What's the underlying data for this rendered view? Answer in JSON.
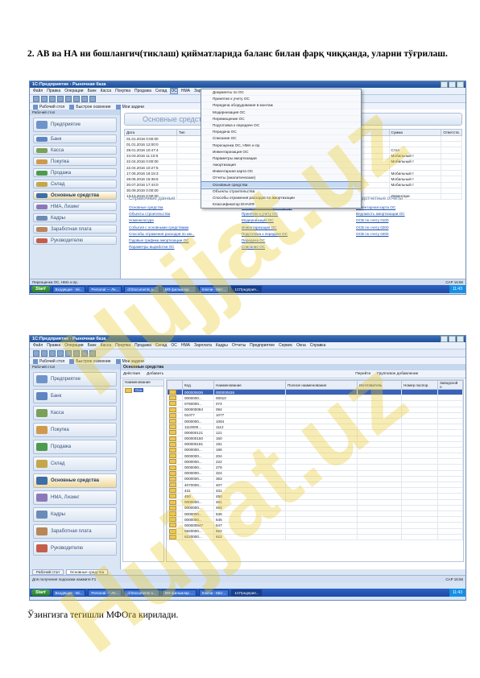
{
  "heading": "2. АВ ва НА ни бошлангич(тиклаш) қийматларида баланс билан фарқ чиққанда, уларни тўғрилаш.",
  "caption": "Ўзингизга тегишли МФОга кирилади.",
  "watermark": "Hujjat.uz",
  "app": {
    "title": "1С:Предприятие - Рыночная база",
    "menu": [
      "Файл",
      "Правка",
      "Операции",
      "Банк",
      "Касса",
      "Покупка",
      "Продажа",
      "Склад",
      "ОС",
      "НМА",
      "Зарплата",
      "Кадры",
      "Отчеты",
      "Предприятие",
      "Сервис",
      "Окна",
      "Справка"
    ],
    "panel": {
      "desktop": "Рабочий стол",
      "quick": "Быстрое освоение",
      "mine": "Мои задачи"
    },
    "side_title": "Рабочий стол",
    "sections": [
      "Предприятие",
      "Банк",
      "Касса",
      "Покупка",
      "Продажа",
      "Склад",
      "Основные средства",
      "НМА, Лизинг",
      "Кадры",
      "Заработная плата",
      "Руководителю"
    ],
    "taskbar": {
      "start": "Start",
      "tasks": [
        "Входящие - Mi...",
        "Personal — Ле...",
        "d:\\Documents a...",
        "МФ фильмлар ...",
        "Ключи - Micr...",
        "1СПредприя..."
      ],
      "clock": "11:43"
    }
  },
  "shot1": {
    "tab": "Основные средства",
    "status": "Переоценка ОС, НМА и пр.",
    "bottom_tab": "Рабочий стол",
    "context_menu": [
      "Документы по ОС",
      "Принятие к учету ОС",
      "Передача оборудования в монтаж",
      "Модернизация ОС",
      "Перемещение ОС",
      "Подготовка к передаче ОС",
      "Передача ОС",
      "Списание ОС",
      "Переоценка ОС, НМА и пр.",
      "Инвентаризация ОС",
      "Параметры амортизации",
      "Амортизация",
      "Инвентарная карта ОС",
      "Отчеты (аналитические)",
      "Основные средства",
      "Объекты строительства",
      "Способы отражения расходов по амортизации",
      "Классификатор ЕНАОФ"
    ],
    "highlighted": "Переоценка ОС, НМА и пр.",
    "list_header": [
      "Дата",
      "Тип",
      "Наименование",
      "Организация",
      "Сумма",
      "Ответств."
    ],
    "list_rows": [
      [
        "01.01.2016 0:00:00",
        "",
        "",
        "МФ",
        ""
      ],
      [
        "01.01.2016 12:00:0",
        "",
        "",
        "МФ",
        ""
      ],
      [
        "28.01.2016 10:47:4",
        "",
        "",
        "МФ",
        "Стол"
      ],
      [
        "24.03.2016 11:10:5",
        "",
        "",
        "МФ",
        "Мобильный т"
      ],
      [
        "22.04.2016 0:00:00",
        "",
        "",
        "МФ",
        "Мобильный т"
      ],
      [
        "22.04.2016 10:27:5",
        "",
        "",
        "МФ",
        ""
      ],
      [
        "17.06.2016 16:15:3",
        "",
        "",
        "МФ",
        "Мобильный т"
      ],
      [
        "28.06.2016 15:36:5",
        "",
        "",
        "МФ",
        "Мобильный т"
      ],
      [
        "20.07.2016 17:44:0",
        "",
        "",
        "МФ",
        "Мобильный т"
      ],
      [
        "30.09.2016 0:00:00",
        "",
        "Основные средства",
        "МФ",
        ""
      ],
      [
        "13.10.2016 0:00:00",
        "",
        "",
        "МФ",
        "Инвентари"
      ]
    ],
    "links_left": [
      "Основные средства",
      "Объекты строительства",
      "Номенклатура",
      "События с основными средствами",
      "Способы отражения расходов по ам...",
      "Годовые графики амортизации ОС",
      "Параметры выработки ОС"
    ],
    "links_mid": [
      "Поступление товаров и услуг",
      "Принятие к учету ОС",
      "Модернизация ОС",
      "Инвентаризация ОС",
      "Подготовка к передаче ОС",
      "Передача ОС",
      "Списание ОС"
    ],
    "links_right": [
      "Инвентарная карта ОС",
      "Ведомость амортизации ОС",
      "ОСВ по счету 0100",
      "ОСВ по счету 0200",
      "ОСВ по счету 0400"
    ],
    "section_docs": "Справочные данные",
    "section_reports": "Подотчетные отчеты",
    "date_right": "CAP 16:56"
  },
  "shot2": {
    "tab": "Основные средства",
    "toolbar": [
      "Действия",
      "Добавить",
      "Перейти",
      "Групповое добавление"
    ],
    "columns": [
      "Наименование",
      "Код",
      "Наименование",
      "Полное наименование",
      "Изготовитель",
      "Номер паспор.",
      "Заводской н"
    ],
    "tree_root": "Осн",
    "rows": [
      [
        "000000636",
        "000000636"
      ],
      [
        "0000000...",
        "00010"
      ],
      [
        "0760000...",
        "074"
      ],
      [
        "000000084",
        "084"
      ],
      [
        "01077",
        "1077"
      ],
      [
        "0000000...",
        "1084"
      ],
      [
        "1110000...",
        "1112"
      ],
      [
        "000000121",
        "121"
      ],
      [
        "000000150",
        "150"
      ],
      [
        "000000191",
        "191"
      ],
      [
        "0000000...",
        "196"
      ],
      [
        "0000000...",
        "204"
      ],
      [
        "0000000...",
        "222"
      ],
      [
        "0000000...",
        "278"
      ],
      [
        "0000000...",
        "324"
      ],
      [
        "0000000...",
        "363"
      ],
      [
        "4070000...",
        "407"
      ],
      [
        "431",
        "431"
      ],
      [
        "450",
        "450"
      ],
      [
        "0000000...",
        "461"
      ],
      [
        "0000000...",
        "493"
      ],
      [
        "0000000...",
        "536"
      ],
      [
        "0000000...",
        "545"
      ],
      [
        "000000547",
        "547"
      ],
      [
        "5820000...",
        "582"
      ],
      [
        "6220000...",
        "622"
      ]
    ],
    "status": "Для получения подсказки нажмите F1",
    "bottom_tabs": [
      "Рабочий стол",
      "Основные средства"
    ],
    "date_right": "CAP 16:56"
  }
}
